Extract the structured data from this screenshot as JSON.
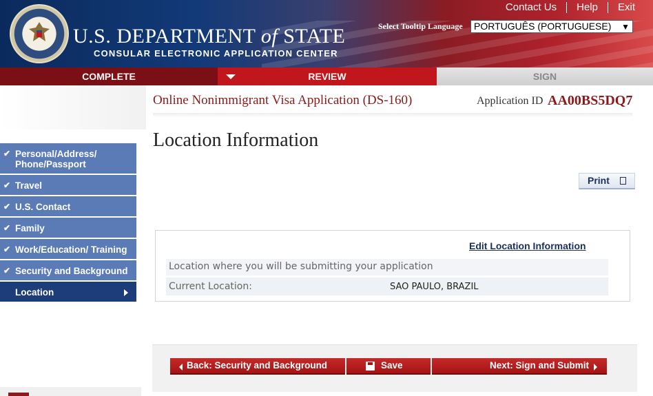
{
  "header": {
    "department": "U.S. DEPARTMENT",
    "department_of": "of",
    "department_state": "STATE",
    "subtitle": "CONSULAR ELECTRONIC APPLICATION CENTER",
    "links": [
      "Contact Us",
      "Help",
      "Exit"
    ],
    "tooltip_language_label": "Select Tooltip Language",
    "tooltip_language_value": "PORTUGUÊS (PORTUGUESE)"
  },
  "progress_tabs": [
    {
      "label": "COMPLETE"
    },
    {
      "label": "REVIEW"
    },
    {
      "label": "SIGN"
    }
  ],
  "application": {
    "title": "Online Nonimmigrant Visa Application (DS-160)",
    "id_label": "Application ID",
    "id_value": "AA00BS5DQ7"
  },
  "page_title": "Location Information",
  "sidebar": {
    "items": [
      {
        "label": "Personal/Address/ Phone/Passport"
      },
      {
        "label": "Travel"
      },
      {
        "label": "U.S. Contact"
      },
      {
        "label": "Family"
      },
      {
        "label": "Work/Education/ Training"
      },
      {
        "label": "Security and Background"
      },
      {
        "label": "Location"
      }
    ]
  },
  "print_label": "Print",
  "location": {
    "edit_link": "Edit Location Information",
    "submitting_label": "Location where you will be submitting your application",
    "current_label": "Current Location:",
    "current_value": "SAO PAULO, BRAZIL"
  },
  "footer_nav": {
    "back": "Back: Security and Background",
    "save": "Save",
    "next": "Next: Sign and Submit"
  },
  "colors": {
    "nav_blue": "#5a7bb6",
    "nav_active": "#1d3c7a",
    "brand_red": "#8b1a1a",
    "button_red": "#b41c1c"
  }
}
